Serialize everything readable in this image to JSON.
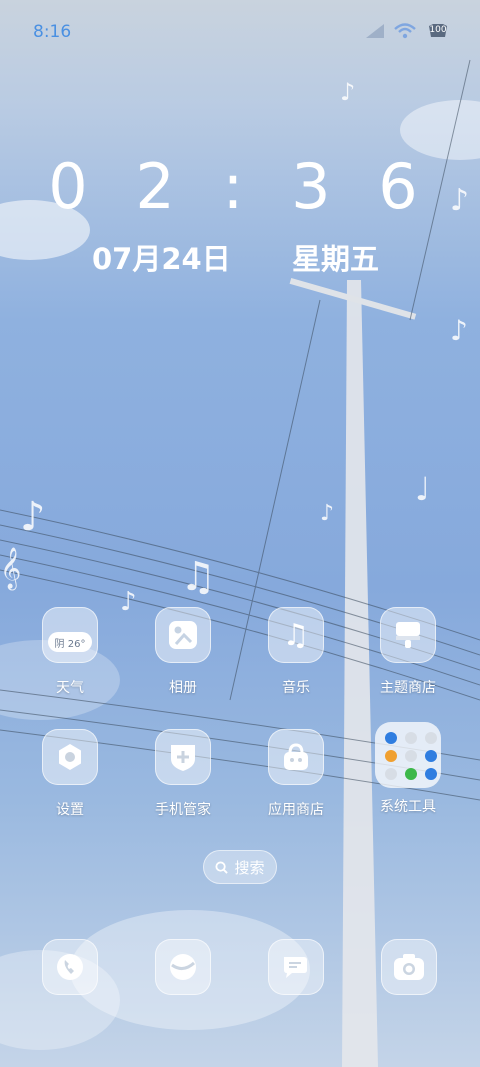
{
  "status_bar": {
    "time": "8:16",
    "battery": "100"
  },
  "lockclock": {
    "time": "0 2 : 3 6",
    "date": "07月24日",
    "weekday": "星期五"
  },
  "apps_row1": [
    {
      "label": "天气",
      "icon": "weather-icon",
      "badge": "阴 26°"
    },
    {
      "label": "相册",
      "icon": "gallery-icon"
    },
    {
      "label": "音乐",
      "icon": "music-icon"
    },
    {
      "label": "主题商店",
      "icon": "theme-store-icon"
    }
  ],
  "apps_row2": [
    {
      "label": "设置",
      "icon": "settings-icon"
    },
    {
      "label": "手机管家",
      "icon": "phone-manager-icon"
    },
    {
      "label": "应用商店",
      "icon": "app-store-icon"
    },
    {
      "label": "系统工具",
      "icon": "folder-icon"
    }
  ],
  "search": {
    "label": "搜索"
  },
  "dock": [
    {
      "name": "phone-icon"
    },
    {
      "name": "browser-icon"
    },
    {
      "name": "messages-icon"
    },
    {
      "name": "camera-icon"
    }
  ],
  "colors": {
    "status_time": "#4a90e2",
    "folder_dots": [
      "#2f7de0",
      "#cfd6df",
      "#cfd6df",
      "#f0a030",
      "#cfd6df",
      "#2f7de0",
      "#cfd6df",
      "#3cb84a",
      "#2f7de0"
    ]
  }
}
